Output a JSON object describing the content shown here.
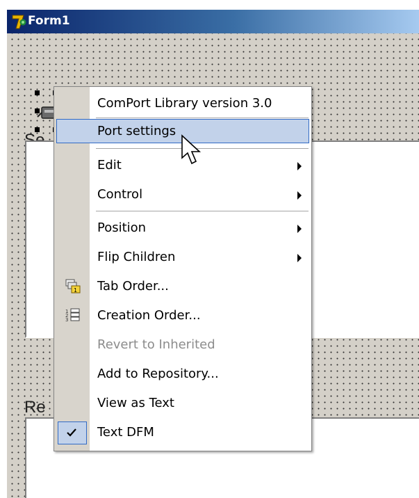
{
  "window": {
    "title": "Form1"
  },
  "groupboxes": {
    "send_label": "Se",
    "receive_label": "Re"
  },
  "context_menu": {
    "items": [
      {
        "label": "ComPort Library version 3.0",
        "submenu": false
      },
      {
        "label": "Port settings",
        "highlighted": true
      },
      {
        "label": "Edit",
        "submenu": true
      },
      {
        "label": "Control",
        "submenu": true
      },
      {
        "label": "Position",
        "submenu": true
      },
      {
        "label": "Flip Children",
        "submenu": true
      },
      {
        "label": "Tab Order...",
        "icon": "tab-order-icon"
      },
      {
        "label": "Creation Order...",
        "icon": "creation-order-icon"
      },
      {
        "label": "Revert to Inherited",
        "disabled": true
      },
      {
        "label": "Add to Repository..."
      },
      {
        "label": "View as Text"
      },
      {
        "label": "Text DFM",
        "checked": true,
        "icon": "checkmark-icon"
      }
    ]
  },
  "colors": {
    "highlight_fill": "#c2d2ea",
    "highlight_border": "#316ac5",
    "titlebar_start": "#0a246a",
    "titlebar_end": "#a6caf0"
  }
}
